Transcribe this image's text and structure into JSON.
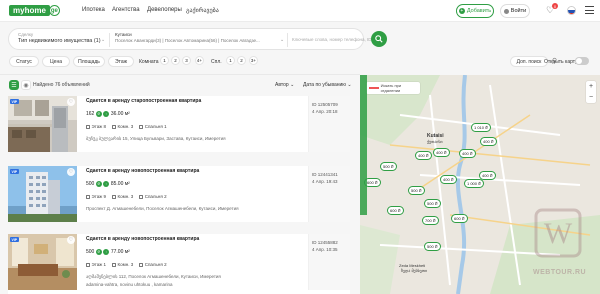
{
  "nav": {
    "logo_word": "myhome",
    "logo_suffix": "ge",
    "links": [
      "Ипотека",
      "Агентства",
      "Девелоперы",
      "გაქირავება"
    ],
    "add_label": "Добавить",
    "login_label": "Войти",
    "favorites_badge": "0"
  },
  "search": {
    "type_label": "Сделку",
    "type_value": "Тип недвижимого имущества (1)",
    "location_label": "Кутаиси",
    "location_value": "Поселок Авангарди(3) | Поселок Автомарина(56) | Поселок Авгадзе...",
    "text_placeholder": "Ключевые слова, номер телефона, ID"
  },
  "filters": {
    "status": "Статус",
    "price": "Цена",
    "area": "Площадь",
    "floor": "Этаж",
    "rooms_label": "Комната",
    "rooms": [
      "1",
      "2",
      "3",
      "4+"
    ],
    "beds_label": "Спл.",
    "beds": [
      "1",
      "2",
      "3+"
    ],
    "more": "Доп. поиск",
    "open_map": "Открыть карту"
  },
  "results": {
    "count_text": "Найдено 76 объявлений",
    "sort_label": "Автор",
    "date_sort": "Дата по убыванию"
  },
  "listings": [
    {
      "vip": "VIP",
      "title": "Сдается в аренду старопостроенная квартира",
      "price": "162",
      "area": "36.00 м²",
      "floor": "Этаж 8",
      "rooms": "Комн. 3",
      "beds": "Спальня 1",
      "address": "ბუჩუკ ბულვარის 15, Улица Бульвари, Заставa, Кутаиси, Имеретия",
      "id": "ID 12505709",
      "date": "4 Апр. 20:18"
    },
    {
      "vip": "VIP",
      "title": "Сдается в аренду новопостроенная квартира",
      "price": "500",
      "area": "85.00 м²",
      "floor": "Этаж 9",
      "rooms": "Комн. 3",
      "beds": "Спальня 2",
      "address": "Проспект Д. Агмашенебели, Поселок Агмашенебели, Кутаиси, Имеретия",
      "id": "ID 12441341",
      "date": "4 Апр. 19:43"
    },
    {
      "vip": "VIP",
      "title": "Сдается в аренду новопостроенная квартира",
      "price": "500",
      "area": "77.00 м²",
      "floor": "Этаж 1",
      "rooms": "Комн. 3",
      "beds": "Спальня 2",
      "address": "აღმაშენებლის 112, Поселок Агмашенебели, Кутаиси, Имеретия",
      "address2": "adamina-vahtra, novinu uhtokuu , kamarina",
      "id": "ID 12455882",
      "date": "4 Апр. 10:35"
    }
  ],
  "map": {
    "search_label": "Искать при отдалении",
    "city": "Kutaisi",
    "city_local": "ქუთაისი",
    "zeda": "Zeda Meskheti",
    "zeda_local": "ზედა მესხეთი",
    "price_markers": [
      "1 010 ₾",
      "400 ₾",
      "400 ₾",
      "400 ₾",
      "400 ₾",
      "500 ₾",
      "400 ₾",
      "400 ₾",
      "600 ₾",
      "500 ₾",
      "500 ₾",
      "600 ₾",
      "600 ₾",
      "1 000 ₾",
      "700 ₾",
      "500 ₾"
    ],
    "zoom_in": "+",
    "zoom_out": "−"
  },
  "watermark": "WEBTOUR.RU",
  "colors": {
    "brand": "#2f9e44",
    "vip": "#2f6fe0"
  }
}
